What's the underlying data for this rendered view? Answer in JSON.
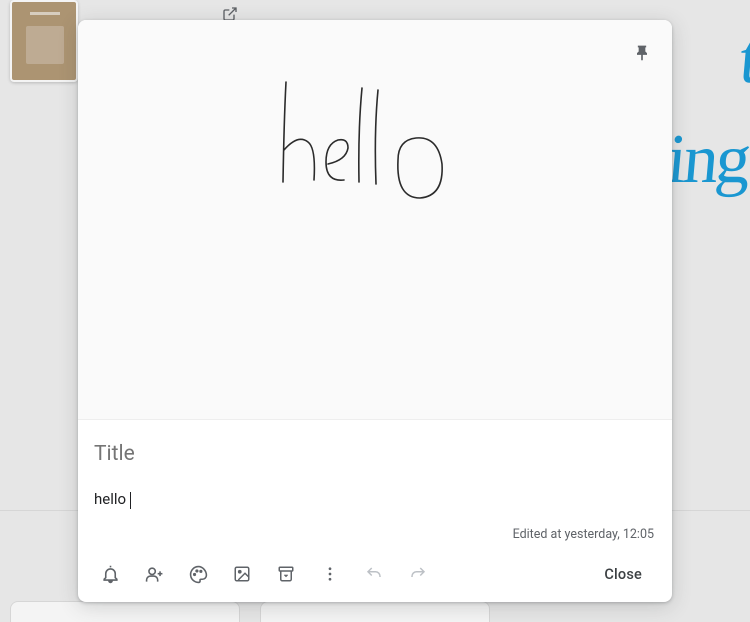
{
  "modal": {
    "title_placeholder": "Title",
    "title_value": "",
    "note_value": "hello",
    "edited_label": "Edited at yesterday, 12:05",
    "close_label": "Close"
  },
  "handwriting_text": "hello",
  "background": {
    "partial_text_1": "t",
    "partial_text_2": "ting"
  },
  "toolbar": {
    "remind": "remind-icon",
    "collaborator": "add-collaborator-icon",
    "palette": "palette-icon",
    "image": "image-icon",
    "archive": "archive-icon",
    "more": "more-icon",
    "undo": "undo-icon",
    "redo": "redo-icon"
  }
}
